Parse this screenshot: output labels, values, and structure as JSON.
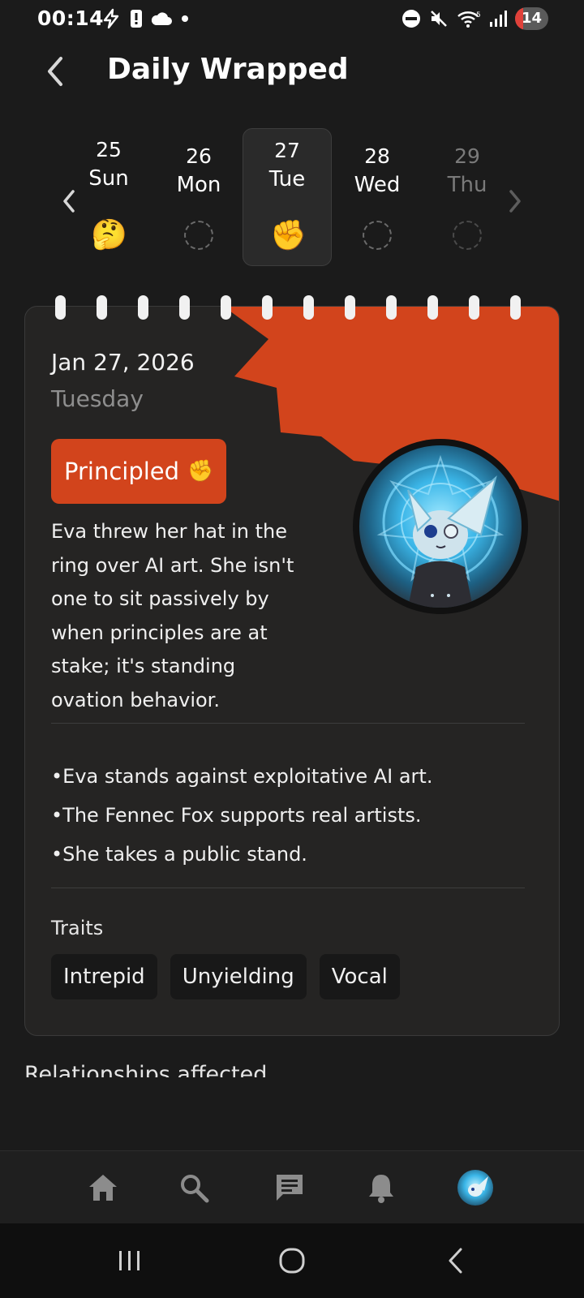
{
  "status_bar": {
    "time": "00:14",
    "battery": "14",
    "left_icons": [
      "bolt-icon",
      "alert-icon",
      "cloud-icon",
      "dot-icon"
    ],
    "right_icons": [
      "dnd-icon",
      "mute-icon",
      "wifi-icon",
      "signal-icon"
    ]
  },
  "header": {
    "title": "Daily Wrapped"
  },
  "date_strip": {
    "days": [
      {
        "num": "25",
        "weekday": "Sun",
        "emoji": "🤔",
        "state": "logged"
      },
      {
        "num": "26",
        "weekday": "Mon",
        "emoji": "",
        "state": "empty"
      },
      {
        "num": "27",
        "weekday": "Tue",
        "emoji": "✊",
        "state": "selected"
      },
      {
        "num": "28",
        "weekday": "Wed",
        "emoji": "",
        "state": "empty"
      },
      {
        "num": "29",
        "weekday": "Thu",
        "emoji": "",
        "state": "future"
      }
    ]
  },
  "card": {
    "date": "Jan 27, 2026",
    "weekday": "Tuesday",
    "mood": "Principled",
    "mood_emoji": "✊",
    "accent_color": "#d2441c",
    "story": "Eva threw her hat in the ring over AI art. She isn't one to sit passively by when principles are at stake; it's standing ovation behavior.",
    "bullets": [
      "•Eva stands against exploitative AI art.",
      "•The Fennec Fox supports real artists.",
      "•She takes a public stand."
    ],
    "traits_label": "Traits",
    "traits": [
      "Intrepid",
      "Unyielding",
      "Vocal"
    ]
  },
  "next_section": {
    "title": "Relationships affected"
  },
  "bottom_nav": {
    "items": [
      "home-icon",
      "search-icon",
      "chat-icon",
      "bell-icon",
      "profile-avatar"
    ]
  },
  "system_nav": {
    "items": [
      "recents-icon",
      "home-circle-icon",
      "back-icon"
    ]
  }
}
